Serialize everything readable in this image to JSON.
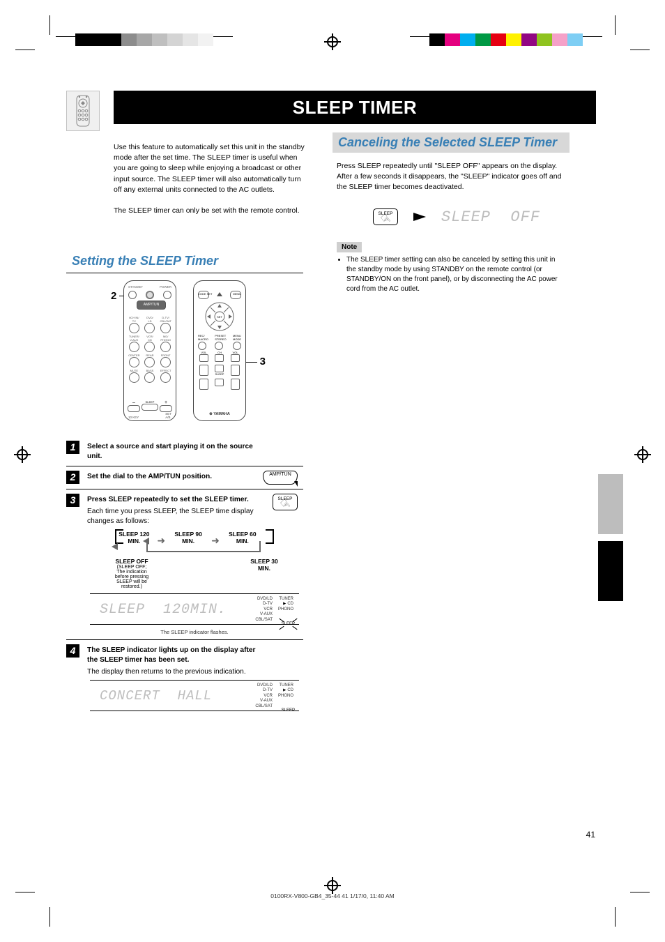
{
  "page_title": "SLEEP TIMER",
  "page_number": "41",
  "footer": "0100RX-V800-GB4_35-44    41    1/17/0, 11:40 AM",
  "intro_left": "Use this feature to automatically set this unit in the standby mode after the set time. The SLEEP timer is useful when you are going to sleep while enjoying a broadcast or other input source. The SLEEP timer will also automatically turn off any external units connected to the AC outlets.\n\nThe SLEEP timer can only be set with the remote control.",
  "left": {
    "subheader": "Setting the SLEEP Timer",
    "callout_2": "2",
    "callout_3": "3",
    "remote_dial": "AMP/TUN",
    "remote_brand": "YAMAHA",
    "steps": {
      "s1": "Select a source and start playing it on the source unit.",
      "s2": "Set the dial to the AMP/TUN position.",
      "s3a": "Press SLEEP repeatedly to set the SLEEP timer.",
      "s3b": "Each time you press SLEEP, the SLEEP time display changes as follows:",
      "s4a": "The SLEEP indicator lights up on the display after the SLEEP timer has been set.",
      "s4b": "The display then returns to the previous indication."
    },
    "seq": [
      "SLEEP 120 MIN.",
      "SLEEP 90 MIN.",
      "SLEEP 60 MIN.",
      "SLEEP 30 MIN."
    ],
    "seq_off": "SLEEP OFF",
    "seq_off_note": "(SLEEP OFF; The indication before pressing SLEEP will be restored.)",
    "lcd1": "SLEEP  120MIN.",
    "lcd2": "CONCERT  HALL",
    "lcd1_caption": "The SLEEP indicator flashes.",
    "lcd_labels": {
      "l1": "DVD/LD",
      "l2": "D-TV",
      "l3": "VCR",
      "l4": "V-AUX",
      "l5": "CBL/SAT",
      "r1": "TUNER",
      "r2": "CD",
      "r3": "PHONO",
      "sleep": "SLEEP"
    }
  },
  "right": {
    "subheader": "Canceling the Selected SLEEP Timer",
    "body": "Press SLEEP repeatedly until \"SLEEP OFF\" appears on the display.\nAfter a few seconds it disappears, the \"SLEEP\" indicator goes off and the SLEEP timer becomes deactivated.",
    "lcd": "SLEEP  OFF",
    "note_head": "Note",
    "note_body": "The SLEEP timer setting can also be canceled by setting this unit in the standby mode by using STANDBY on the remote control (or STANDBY/ON on the front panel), or by disconnecting the AC power cord from the AC outlet."
  },
  "colors": {
    "left_strip": [
      "#000",
      "#000",
      "#000",
      "#8c8c8c",
      "#a7a7a7",
      "#bfbfbf",
      "#d4d4d4",
      "#e5e5e5",
      "#f2f2f2"
    ],
    "right_strip": [
      "#000",
      "#e4007f",
      "#00aeef",
      "#009944",
      "#e60012",
      "#fff100",
      "#920783",
      "#8fc31f",
      "#f5a1c8",
      "#7ecef4"
    ]
  }
}
